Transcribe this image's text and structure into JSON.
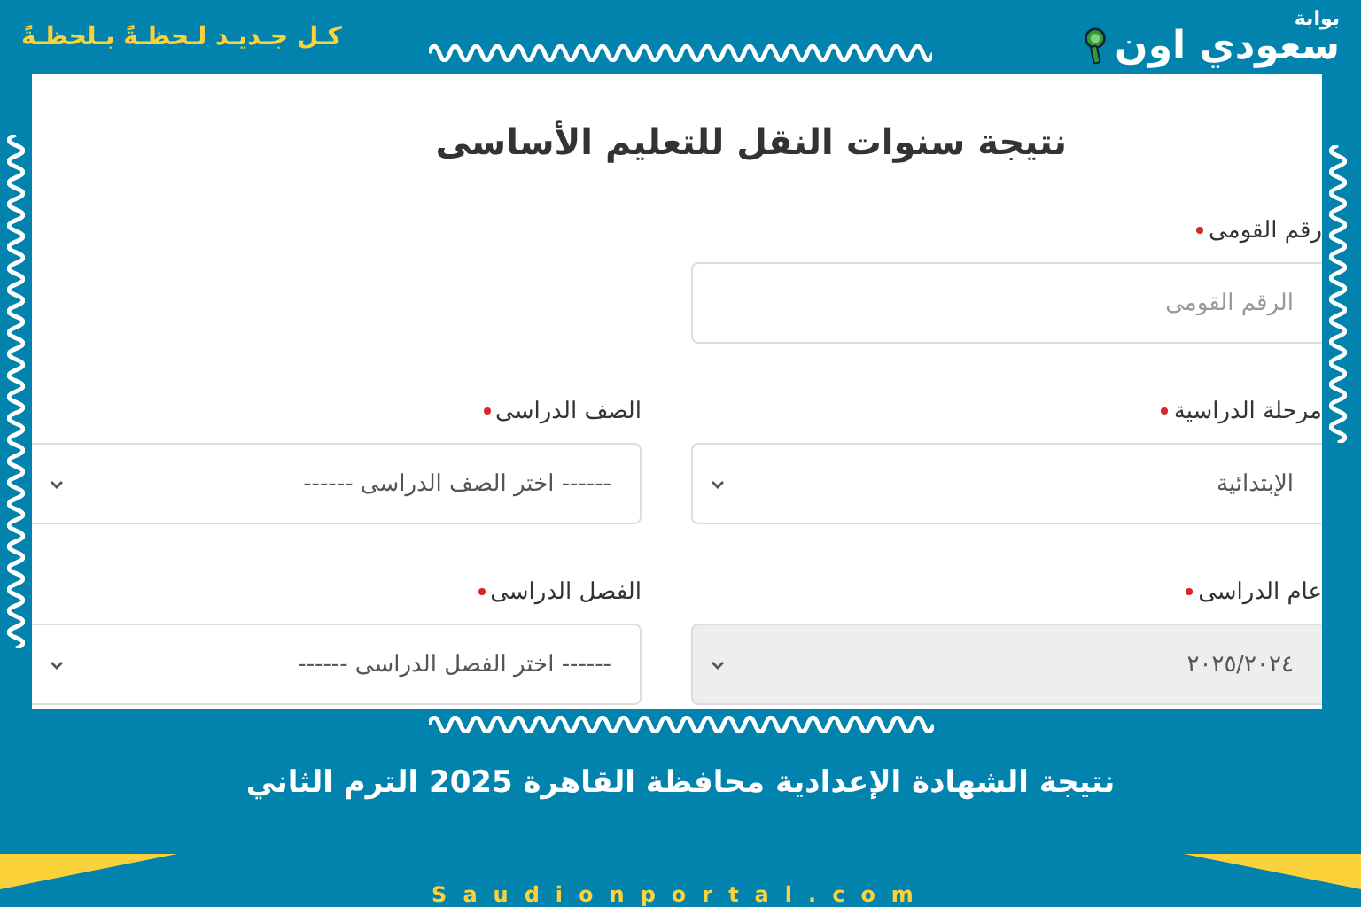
{
  "header": {
    "slogan": "كـل جـديـد لـحظـةً بـلحظـةً",
    "logo": {
      "small": "بوابة",
      "main": "سعودي اون"
    }
  },
  "form": {
    "title": "نتيجة سنوات النقل للتعليم الأساسى",
    "fields": [
      {
        "kind": "text",
        "label": "رقم القومى",
        "required": true,
        "placeholder": "الرقم القومى"
      },
      {
        "kind": "blank"
      },
      {
        "kind": "select",
        "label": "مرحلة الدراسية",
        "required": true,
        "value": "الإبتدائية",
        "disabled": false
      },
      {
        "kind": "select",
        "label": "الصف الدراسى",
        "required": true,
        "value": "------ اختر الصف الدراسى ------",
        "disabled": false
      },
      {
        "kind": "select",
        "label": "عام الدراسى",
        "required": true,
        "value": "٢٠٢٥/٢٠٢٤",
        "disabled": true
      },
      {
        "kind": "select",
        "label": "الفصل الدراسى",
        "required": true,
        "value": "------ اختر الفصل الدراسى ------",
        "disabled": false
      }
    ]
  },
  "headline": "نتيجة الشهادة الإعدادية محافظة القاهرة 2025 الترم الثاني",
  "site_url": "Saudionportal.com"
}
